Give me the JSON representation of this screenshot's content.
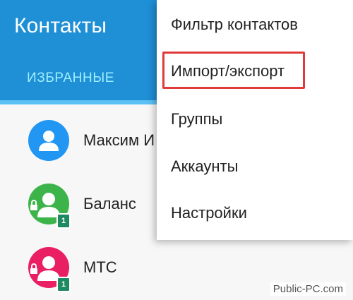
{
  "header": {
    "title": "Контакты",
    "tab_favorites": "ИЗБРАННЫЕ"
  },
  "contacts": [
    {
      "name": "Максим И",
      "avatar_color": "#2196f3",
      "badge": ""
    },
    {
      "name": "Баланс",
      "avatar_color": "#3db44a",
      "badge": "1"
    },
    {
      "name": "МТС",
      "avatar_color": "#e91e63",
      "badge": "1"
    }
  ],
  "menu": {
    "items": [
      {
        "label": "Фильтр контактов"
      },
      {
        "label": "Импорт/экспорт",
        "highlighted": true
      },
      {
        "label": "Группы"
      },
      {
        "label": "Аккаунты"
      },
      {
        "label": "Настройки"
      }
    ]
  },
  "watermark": "Public-PC.com",
  "colors": {
    "appbar": "#1f8fd6",
    "tab_text": "#9ff0ff",
    "highlight": "#e03a3a",
    "sim_badge": "#1d8a62"
  }
}
